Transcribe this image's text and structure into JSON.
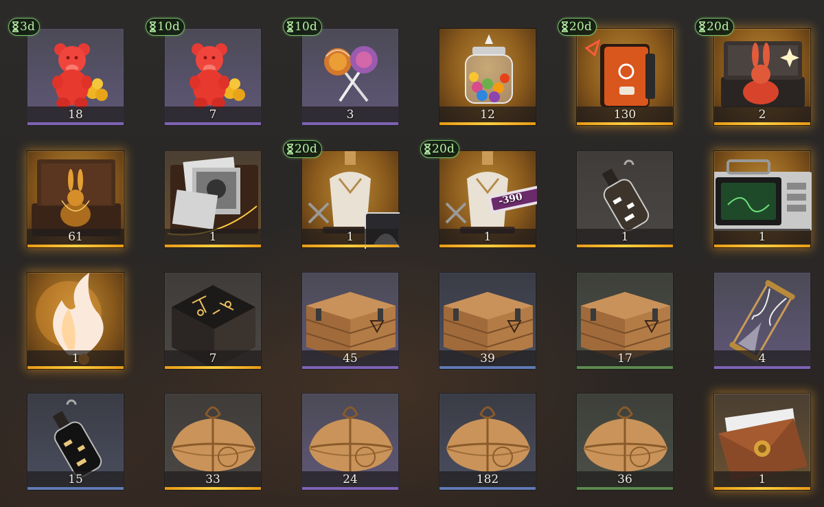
{
  "inventory": {
    "slots": [
      {
        "id": "s0",
        "item": "red-gummy-bear",
        "rarity": "purple",
        "count": "18",
        "timer": "3d"
      },
      {
        "id": "s1",
        "item": "red-gummy-bear",
        "rarity": "purple",
        "count": "7",
        "timer": "10d"
      },
      {
        "id": "s2",
        "item": "lollipops",
        "rarity": "purple",
        "count": "3",
        "timer": "10d"
      },
      {
        "id": "s3",
        "item": "candy-jar",
        "rarity": "gold",
        "count": "12",
        "timer": ""
      },
      {
        "id": "s4",
        "item": "orange-journal",
        "rarity": "gold",
        "count": "130",
        "timer": "20d"
      },
      {
        "id": "s5",
        "item": "rabbit-case",
        "rarity": "gold",
        "count": "2",
        "timer": "20d"
      },
      {
        "id": "s6",
        "item": "golden-rabbit-box",
        "rarity": "gold",
        "count": "61",
        "timer": ""
      },
      {
        "id": "s7",
        "item": "photo-box",
        "rarity": "gold",
        "count": "1",
        "timer": ""
      },
      {
        "id": "s8",
        "item": "tailor-mannequin",
        "rarity": "gold",
        "count": "1",
        "timer": "20d"
      },
      {
        "id": "s9",
        "item": "tailor-coupon",
        "rarity": "gold",
        "count": "1",
        "timer": "20d",
        "badge": "-390"
      },
      {
        "id": "s10",
        "item": "message-bottle",
        "rarity": "gold",
        "count": "1",
        "timer": ""
      },
      {
        "id": "s11",
        "item": "radar-device",
        "rarity": "gold",
        "count": "1",
        "timer": ""
      },
      {
        "id": "s12",
        "item": "glowing-flame",
        "rarity": "gold",
        "count": "1",
        "timer": ""
      },
      {
        "id": "s13",
        "item": "rune-cube",
        "rarity": "gold",
        "count": "7",
        "timer": ""
      },
      {
        "id": "s14",
        "item": "wooden-crate",
        "rarity": "purple",
        "count": "45",
        "timer": ""
      },
      {
        "id": "s15",
        "item": "wooden-crate",
        "rarity": "blue",
        "count": "39",
        "timer": ""
      },
      {
        "id": "s16",
        "item": "wooden-crate",
        "rarity": "green",
        "count": "17",
        "timer": ""
      },
      {
        "id": "s17",
        "item": "brass-hourglass",
        "rarity": "purple",
        "count": "4",
        "timer": ""
      },
      {
        "id": "s18",
        "item": "black-bottle",
        "rarity": "blue",
        "count": "15",
        "timer": ""
      },
      {
        "id": "s19",
        "item": "paper-parcel",
        "rarity": "gold",
        "count": "33",
        "timer": ""
      },
      {
        "id": "s20",
        "item": "paper-parcel",
        "rarity": "purple",
        "count": "24",
        "timer": ""
      },
      {
        "id": "s21",
        "item": "paper-parcel",
        "rarity": "blue",
        "count": "182",
        "timer": ""
      },
      {
        "id": "s22",
        "item": "paper-parcel",
        "rarity": "green",
        "count": "36",
        "timer": ""
      },
      {
        "id": "s23",
        "item": "sealed-envelope",
        "rarity": "gold",
        "count": "1",
        "timer": ""
      }
    ]
  },
  "colors": {
    "purple": "#7f63b6",
    "gold": "#ffcf40",
    "blue": "#5f7bb3",
    "green": "#5c8a4e",
    "timer_text": "#b9efa6",
    "timer_border": "#7fc36e"
  }
}
